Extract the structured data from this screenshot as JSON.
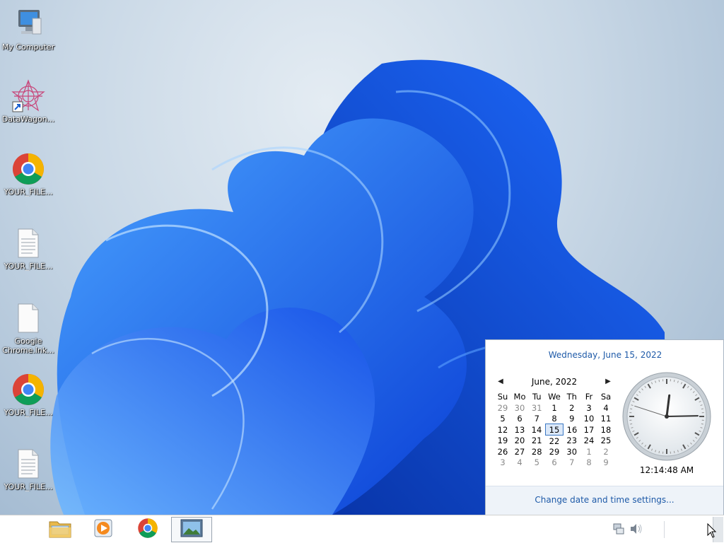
{
  "desktop": {
    "icons": [
      {
        "label": "My Computer",
        "icon": "computer-icon"
      },
      {
        "label": "DataWagon...",
        "icon": "datawagon-icon"
      },
      {
        "label": "YOUR_FILE...",
        "icon": "chrome-icon"
      },
      {
        "label": "YOUR_FILE...",
        "icon": "text-file-icon"
      },
      {
        "label": "Google",
        "label2": "Chrome.lnk...",
        "icon": "blank-file-icon"
      },
      {
        "label": "YOUR_FILE...",
        "icon": "chrome-icon"
      },
      {
        "label": "YOUR_FILE...",
        "icon": "text-file-icon"
      }
    ]
  },
  "taskbar": {
    "buttons": [
      {
        "name": "file-explorer-icon"
      },
      {
        "name": "media-player-icon"
      },
      {
        "name": "chrome-icon"
      },
      {
        "name": "image-viewer-icon",
        "active": true
      }
    ],
    "tray": [
      "network-icon",
      "volume-icon"
    ]
  },
  "clock_flyout": {
    "long_date": "Wednesday, June 15, 2022",
    "month_label": "June, 2022",
    "weekdays": [
      "Su",
      "Mo",
      "Tu",
      "We",
      "Th",
      "Fr",
      "Sa"
    ],
    "weeks": [
      [
        "29",
        "30",
        "31",
        "1",
        "2",
        "3",
        "4"
      ],
      [
        "5",
        "6",
        "7",
        "8",
        "9",
        "10",
        "11"
      ],
      [
        "12",
        "13",
        "14",
        "15",
        "16",
        "17",
        "18"
      ],
      [
        "19",
        "20",
        "21",
        "22",
        "23",
        "24",
        "25"
      ],
      [
        "26",
        "27",
        "28",
        "29",
        "30",
        "1",
        "2"
      ],
      [
        "3",
        "4",
        "5",
        "6",
        "7",
        "8",
        "9"
      ]
    ],
    "other_month_cells": [
      [
        0,
        0
      ],
      [
        0,
        1
      ],
      [
        0,
        2
      ],
      [
        4,
        5
      ],
      [
        4,
        6
      ],
      [
        5,
        0
      ],
      [
        5,
        1
      ],
      [
        5,
        2
      ],
      [
        5,
        3
      ],
      [
        5,
        4
      ],
      [
        5,
        5
      ],
      [
        5,
        6
      ]
    ],
    "today_cell": [
      2,
      3
    ],
    "time": "12:14:48 AM",
    "clock": {
      "hour": 0,
      "minute": 14,
      "second": 48
    },
    "change_link": "Change date and time settings..."
  },
  "colors": {
    "link": "#1e5aa8",
    "accent": "#3a77c4"
  }
}
